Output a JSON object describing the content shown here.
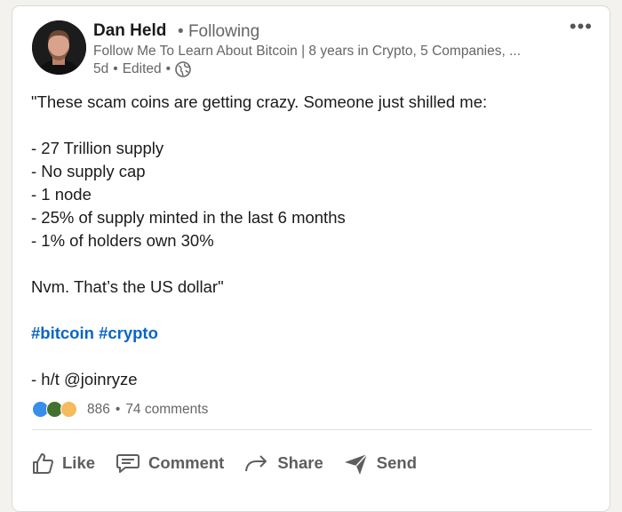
{
  "author": {
    "name": "Dan Held",
    "separator": " • ",
    "following": "Following",
    "headline": "Follow Me To Learn About Bitcoin | 8 years in Crypto, 5 Companies, ...",
    "time": "5d",
    "edited": "Edited",
    "dot": "•"
  },
  "more_label": "•••",
  "post": {
    "line1": "\"These scam coins are getting crazy. Someone just shilled me:",
    "bullets": [
      "- 27 Trillion supply",
      "- No supply cap",
      "- 1 node",
      "- 25% of supply minted in the last 6 months",
      "- 1% of holders own 30%"
    ],
    "punchline": "Nvm. That’s the US dollar\"",
    "hashtags": [
      "#bitcoin",
      "#crypto"
    ],
    "hat_tip": "- h/t @joinryze"
  },
  "social": {
    "reaction_count": "886",
    "separator": "•",
    "comments": "74 comments"
  },
  "actions": {
    "like": "Like",
    "comment": "Comment",
    "share": "Share",
    "send": "Send"
  },
  "colors": {
    "hashtag": "#0a66c2",
    "like_reaction": "#378fe9",
    "celebrate_reaction": "#44712e",
    "insight_reaction": "#f5bb5c"
  }
}
